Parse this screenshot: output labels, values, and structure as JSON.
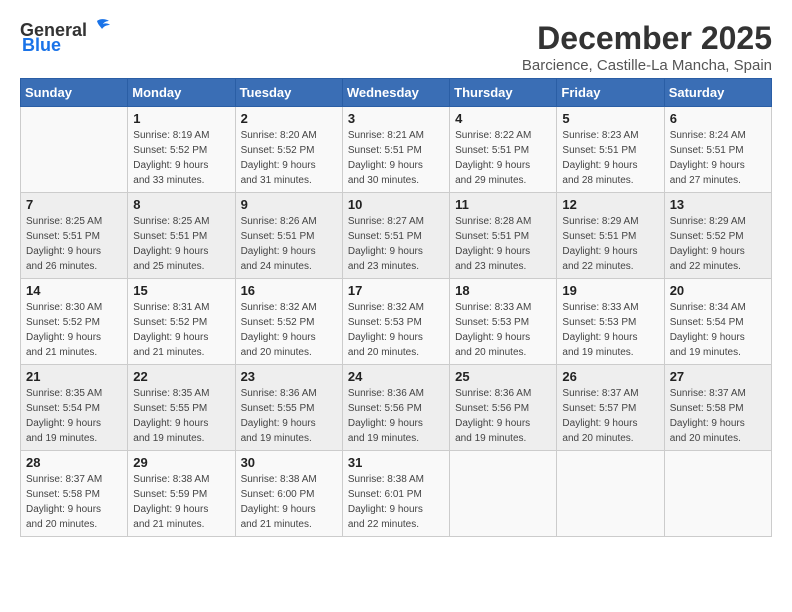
{
  "header": {
    "logo_general": "General",
    "logo_blue": "Blue",
    "month": "December 2025",
    "location": "Barcience, Castille-La Mancha, Spain"
  },
  "weekdays": [
    "Sunday",
    "Monday",
    "Tuesday",
    "Wednesday",
    "Thursday",
    "Friday",
    "Saturday"
  ],
  "weeks": [
    [
      {
        "day": "",
        "info": ""
      },
      {
        "day": "1",
        "info": "Sunrise: 8:19 AM\nSunset: 5:52 PM\nDaylight: 9 hours\nand 33 minutes."
      },
      {
        "day": "2",
        "info": "Sunrise: 8:20 AM\nSunset: 5:52 PM\nDaylight: 9 hours\nand 31 minutes."
      },
      {
        "day": "3",
        "info": "Sunrise: 8:21 AM\nSunset: 5:51 PM\nDaylight: 9 hours\nand 30 minutes."
      },
      {
        "day": "4",
        "info": "Sunrise: 8:22 AM\nSunset: 5:51 PM\nDaylight: 9 hours\nand 29 minutes."
      },
      {
        "day": "5",
        "info": "Sunrise: 8:23 AM\nSunset: 5:51 PM\nDaylight: 9 hours\nand 28 minutes."
      },
      {
        "day": "6",
        "info": "Sunrise: 8:24 AM\nSunset: 5:51 PM\nDaylight: 9 hours\nand 27 minutes."
      }
    ],
    [
      {
        "day": "7",
        "info": "Sunrise: 8:25 AM\nSunset: 5:51 PM\nDaylight: 9 hours\nand 26 minutes."
      },
      {
        "day": "8",
        "info": "Sunrise: 8:25 AM\nSunset: 5:51 PM\nDaylight: 9 hours\nand 25 minutes."
      },
      {
        "day": "9",
        "info": "Sunrise: 8:26 AM\nSunset: 5:51 PM\nDaylight: 9 hours\nand 24 minutes."
      },
      {
        "day": "10",
        "info": "Sunrise: 8:27 AM\nSunset: 5:51 PM\nDaylight: 9 hours\nand 23 minutes."
      },
      {
        "day": "11",
        "info": "Sunrise: 8:28 AM\nSunset: 5:51 PM\nDaylight: 9 hours\nand 23 minutes."
      },
      {
        "day": "12",
        "info": "Sunrise: 8:29 AM\nSunset: 5:51 PM\nDaylight: 9 hours\nand 22 minutes."
      },
      {
        "day": "13",
        "info": "Sunrise: 8:29 AM\nSunset: 5:52 PM\nDaylight: 9 hours\nand 22 minutes."
      }
    ],
    [
      {
        "day": "14",
        "info": "Sunrise: 8:30 AM\nSunset: 5:52 PM\nDaylight: 9 hours\nand 21 minutes."
      },
      {
        "day": "15",
        "info": "Sunrise: 8:31 AM\nSunset: 5:52 PM\nDaylight: 9 hours\nand 21 minutes."
      },
      {
        "day": "16",
        "info": "Sunrise: 8:32 AM\nSunset: 5:52 PM\nDaylight: 9 hours\nand 20 minutes."
      },
      {
        "day": "17",
        "info": "Sunrise: 8:32 AM\nSunset: 5:53 PM\nDaylight: 9 hours\nand 20 minutes."
      },
      {
        "day": "18",
        "info": "Sunrise: 8:33 AM\nSunset: 5:53 PM\nDaylight: 9 hours\nand 20 minutes."
      },
      {
        "day": "19",
        "info": "Sunrise: 8:33 AM\nSunset: 5:53 PM\nDaylight: 9 hours\nand 19 minutes."
      },
      {
        "day": "20",
        "info": "Sunrise: 8:34 AM\nSunset: 5:54 PM\nDaylight: 9 hours\nand 19 minutes."
      }
    ],
    [
      {
        "day": "21",
        "info": "Sunrise: 8:35 AM\nSunset: 5:54 PM\nDaylight: 9 hours\nand 19 minutes."
      },
      {
        "day": "22",
        "info": "Sunrise: 8:35 AM\nSunset: 5:55 PM\nDaylight: 9 hours\nand 19 minutes."
      },
      {
        "day": "23",
        "info": "Sunrise: 8:36 AM\nSunset: 5:55 PM\nDaylight: 9 hours\nand 19 minutes."
      },
      {
        "day": "24",
        "info": "Sunrise: 8:36 AM\nSunset: 5:56 PM\nDaylight: 9 hours\nand 19 minutes."
      },
      {
        "day": "25",
        "info": "Sunrise: 8:36 AM\nSunset: 5:56 PM\nDaylight: 9 hours\nand 19 minutes."
      },
      {
        "day": "26",
        "info": "Sunrise: 8:37 AM\nSunset: 5:57 PM\nDaylight: 9 hours\nand 20 minutes."
      },
      {
        "day": "27",
        "info": "Sunrise: 8:37 AM\nSunset: 5:58 PM\nDaylight: 9 hours\nand 20 minutes."
      }
    ],
    [
      {
        "day": "28",
        "info": "Sunrise: 8:37 AM\nSunset: 5:58 PM\nDaylight: 9 hours\nand 20 minutes."
      },
      {
        "day": "29",
        "info": "Sunrise: 8:38 AM\nSunset: 5:59 PM\nDaylight: 9 hours\nand 21 minutes."
      },
      {
        "day": "30",
        "info": "Sunrise: 8:38 AM\nSunset: 6:00 PM\nDaylight: 9 hours\nand 21 minutes."
      },
      {
        "day": "31",
        "info": "Sunrise: 8:38 AM\nSunset: 6:01 PM\nDaylight: 9 hours\nand 22 minutes."
      },
      {
        "day": "",
        "info": ""
      },
      {
        "day": "",
        "info": ""
      },
      {
        "day": "",
        "info": ""
      }
    ]
  ]
}
